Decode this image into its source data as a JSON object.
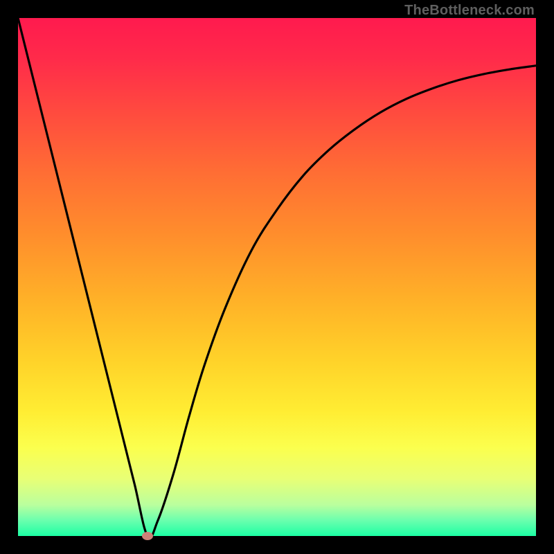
{
  "watermark": "TheBottleneck.com",
  "colors": {
    "frame_bg": "#000000",
    "marker_fill": "#cf8178",
    "curve_stroke": "#000000",
    "gradient_stops": [
      {
        "offset": "0%",
        "color": "#ff1a4e"
      },
      {
        "offset": "8%",
        "color": "#ff2b4a"
      },
      {
        "offset": "18%",
        "color": "#ff4a3f"
      },
      {
        "offset": "30%",
        "color": "#ff6e34"
      },
      {
        "offset": "42%",
        "color": "#ff8e2c"
      },
      {
        "offset": "54%",
        "color": "#ffb028"
      },
      {
        "offset": "66%",
        "color": "#ffd229"
      },
      {
        "offset": "76%",
        "color": "#ffed33"
      },
      {
        "offset": "83%",
        "color": "#fbff4e"
      },
      {
        "offset": "89%",
        "color": "#e8ff76"
      },
      {
        "offset": "94%",
        "color": "#baff9e"
      },
      {
        "offset": "97%",
        "color": "#6affae"
      },
      {
        "offset": "100%",
        "color": "#1cffa4"
      }
    ]
  },
  "chart_data": {
    "type": "line",
    "title": "",
    "xlabel": "",
    "ylabel": "",
    "xlim": [
      0,
      100
    ],
    "ylim": [
      0,
      100
    ],
    "grid": false,
    "series": [
      {
        "name": "bottleneck-curve",
        "x": [
          0,
          5,
          10,
          15,
          20,
          22.5,
          25,
          27,
          30,
          33,
          36,
          40,
          45,
          50,
          55,
          60,
          65,
          70,
          75,
          80,
          85,
          90,
          95,
          100
        ],
        "y": [
          100,
          80,
          60,
          40,
          20,
          10,
          0,
          3,
          12,
          23,
          33,
          44,
          55,
          63,
          69.5,
          74.5,
          78.5,
          81.8,
          84.4,
          86.4,
          88,
          89.2,
          90.1,
          90.8
        ]
      }
    ],
    "marker": {
      "x": 25,
      "y": 0
    },
    "annotations": []
  }
}
